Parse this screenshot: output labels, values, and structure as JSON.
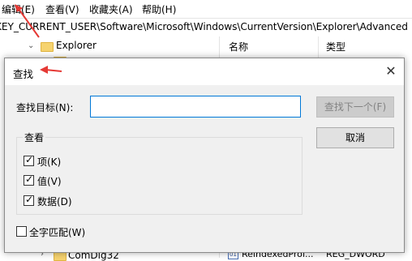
{
  "menubar": {
    "items": [
      "编辑(E)",
      "查看(V)",
      "收藏夹(A)",
      "帮助(H)"
    ]
  },
  "address": {
    "path": "KEY_CURRENT_USER\\Software\\Microsoft\\Windows\\CurrentVersion\\Explorer\\Advanced"
  },
  "tree": {
    "items": [
      "Explorer",
      "ComDlg32"
    ]
  },
  "list": {
    "columns": [
      "名称",
      "类型"
    ],
    "rows": [
      {
        "name": "ReindexedProf...",
        "type": "REG_DWORD"
      }
    ]
  },
  "dialog": {
    "title": "查找",
    "close_glyph": "✕",
    "find_label": "查找目标(N):",
    "find_value": "",
    "find_next": "查找下一个(F)",
    "cancel": "取消",
    "look_at_title": "查看",
    "options": [
      {
        "label": "项(K)",
        "checked": true
      },
      {
        "label": "值(V)",
        "checked": true
      },
      {
        "label": "数据(D)",
        "checked": true
      }
    ],
    "whole_string": {
      "label": "全字匹配(W)",
      "checked": false
    }
  },
  "colors": {
    "annotation_arrow": "#e53935",
    "input_focus": "#0078d7"
  }
}
